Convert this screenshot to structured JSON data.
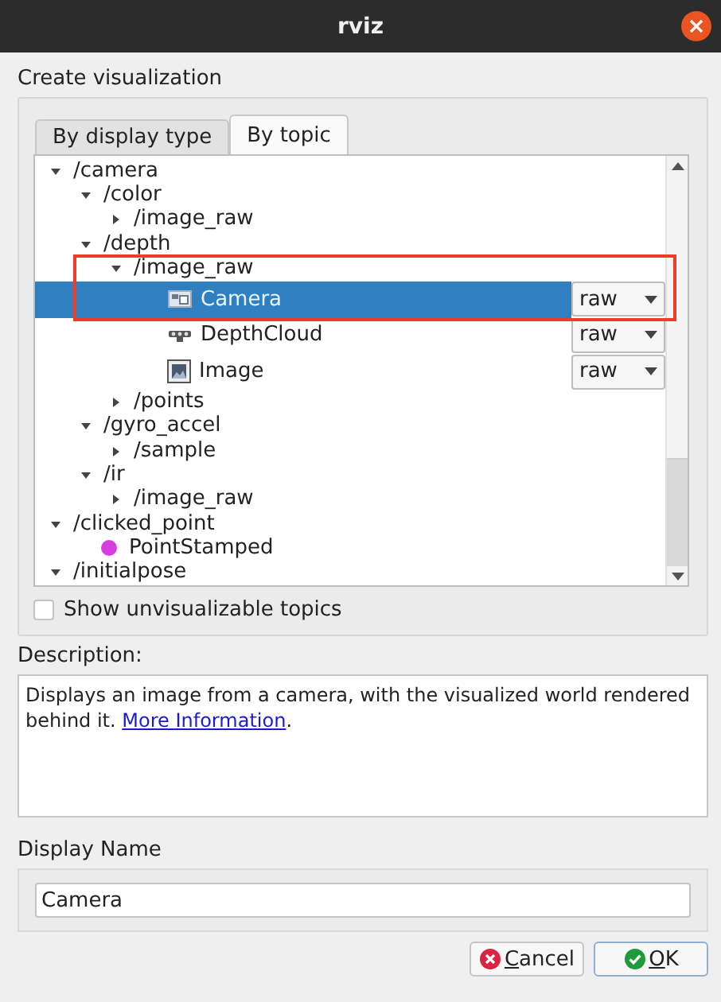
{
  "window": {
    "title": "rviz"
  },
  "create_label": "Create visualization",
  "tabs": [
    {
      "label": "By display type",
      "selected": false
    },
    {
      "label": "By topic",
      "selected": true
    }
  ],
  "tree": [
    {
      "label": "/camera",
      "kind": "topic",
      "expanded": true,
      "selected": false,
      "children": [
        {
          "label": "/color",
          "kind": "topic",
          "expanded": true,
          "selected": false,
          "children": [
            {
              "label": "/image_raw",
              "kind": "topic",
              "expanded": false,
              "selected": false
            }
          ]
        },
        {
          "label": "/depth",
          "kind": "topic",
          "expanded": true,
          "selected": false,
          "children": [
            {
              "label": "/image_raw",
              "kind": "topic",
              "expanded": true,
              "selected": false,
              "children": [
                {
                  "label": "Camera",
                  "kind": "camera",
                  "selected": true,
                  "transport": "raw"
                },
                {
                  "label": "DepthCloud",
                  "kind": "depthcloud",
                  "selected": false,
                  "transport": "raw"
                },
                {
                  "label": "Image",
                  "kind": "image",
                  "selected": false,
                  "transport": "raw"
                }
              ]
            },
            {
              "label": "/points",
              "kind": "topic",
              "expanded": false,
              "selected": false
            }
          ]
        },
        {
          "label": "/gyro_accel",
          "kind": "topic",
          "expanded": true,
          "selected": false,
          "children": [
            {
              "label": "/sample",
              "kind": "topic",
              "expanded": false,
              "selected": false
            }
          ]
        },
        {
          "label": "/ir",
          "kind": "topic",
          "expanded": true,
          "selected": false,
          "children": [
            {
              "label": "/image_raw",
              "kind": "topic",
              "expanded": false,
              "selected": false
            }
          ]
        }
      ]
    },
    {
      "label": "/clicked_point",
      "kind": "topic",
      "expanded": true,
      "selected": false,
      "children": [
        {
          "label": "PointStamped",
          "kind": "point",
          "selected": false
        }
      ]
    },
    {
      "label": "/initialpose",
      "kind": "topic",
      "expanded": true,
      "selected": false
    }
  ],
  "show_unvisualizable": {
    "label": "Show unvisualizable topics",
    "checked": false
  },
  "description": {
    "label": "Description:",
    "text": "Displays an image from a camera, with the visualized world rendered behind it. ",
    "link": "More Information",
    "trailing": "."
  },
  "display_name": {
    "label": "Display Name",
    "value": "Camera"
  },
  "buttons": [
    {
      "label": "Cancel",
      "kind": "cancel"
    },
    {
      "label": "OK",
      "kind": "ok"
    }
  ]
}
